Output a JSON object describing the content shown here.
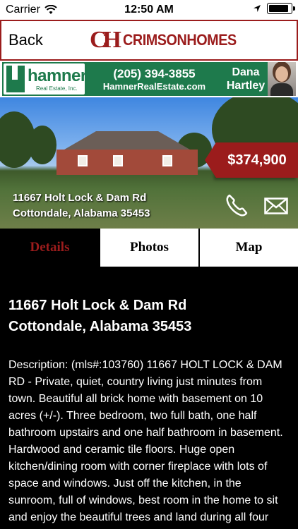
{
  "status_bar": {
    "carrier": "Carrier",
    "time": "12:50 AM",
    "battery_level": 0.9
  },
  "nav": {
    "back_label": "Back",
    "logo_monogram": "CH",
    "logo_text": "CRIMSONHOMES"
  },
  "agent_banner": {
    "brokerage_name": "hamner",
    "brokerage_sub": "Real Estate, Inc.",
    "phone": "(205) 394-3855",
    "website": "HamnerRealEstate.com",
    "agent_name_first": "Dana",
    "agent_name_last": "Hartley"
  },
  "listing": {
    "price": "$374,900",
    "address_line1": "11667 Holt Lock & Dam Rd",
    "address_line2": "Cottondale, Alabama 35453"
  },
  "tabs": [
    {
      "label": "Details",
      "active": true
    },
    {
      "label": "Photos",
      "active": false
    },
    {
      "label": "Map",
      "active": false
    }
  ],
  "details": {
    "address_line1": "11667 Holt Lock & Dam Rd",
    "address_line2": "Cottondale, Alabama 35453",
    "description": "Description: (mls#:103760) 11667 HOLT LOCK & DAM RD - Private, quiet, country living just minutes from town. Beautiful all brick home with basement on 10 acres (+/-). Three bedroom, two full bath, one half bathroom upstairs and one half bathroom in basement. Hardwood and ceramic tile floors. Huge open kitchen/dining room with corner fireplace with lots of space and windows. Just off the kitchen, in the sunroom, full of windows, best room in the home to sit and enjoy the beautiful trees and land during all four seasons. Next in a large remodeled"
  },
  "colors": {
    "crimson": "#9b1c1c",
    "hamner_green": "#1e7a4c"
  }
}
